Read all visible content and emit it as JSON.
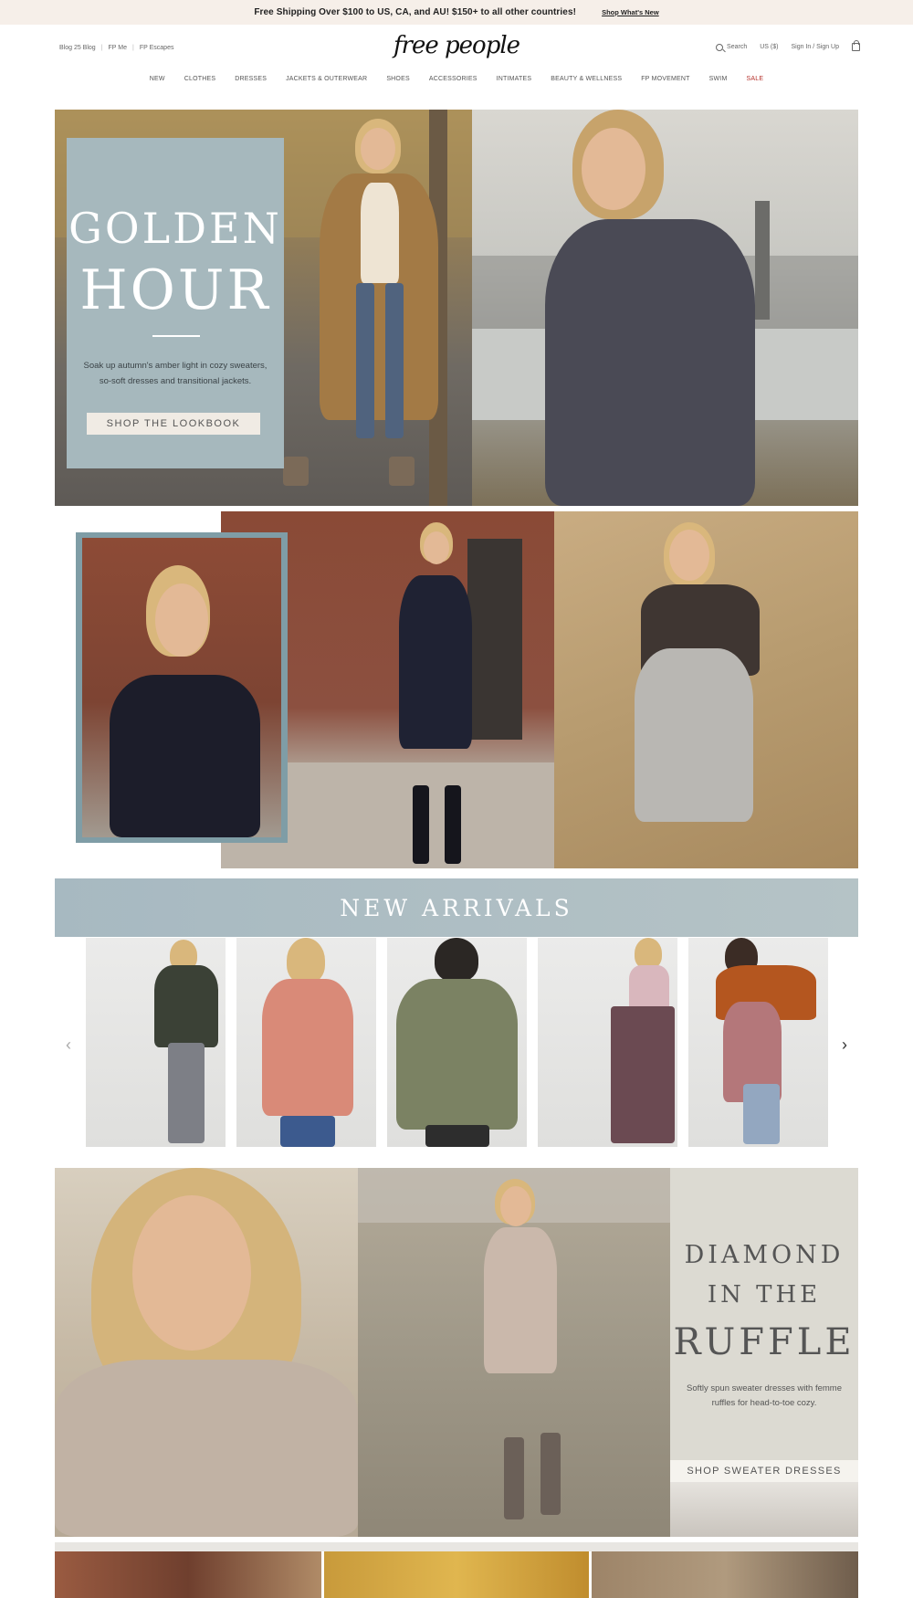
{
  "promo": {
    "message": "Free Shipping Over $100 to US, CA, and AU! $150+ to all other countries!",
    "link": "Shop What's New"
  },
  "header": {
    "util_left": [
      "Blog 25 Blog",
      "FP Me",
      "FP Escapes"
    ],
    "logo": "free people",
    "search": "Search",
    "currency": "US ($)",
    "account": "Sign In / Sign Up",
    "icons": [
      "search-icon",
      "shopping-bag-icon"
    ]
  },
  "nav": {
    "items": [
      "NEW",
      "CLOTHES",
      "DRESSES",
      "JACKETS & OUTERWEAR",
      "SHOES",
      "ACCESSORIES",
      "INTIMATES",
      "BEAUTY & WELLNESS",
      "FP MOVEMENT",
      "SWIM",
      "SALE"
    ],
    "sale_color": "#b5302a"
  },
  "hero": {
    "title_line1": "GOLDEN",
    "title_line2": "HOUR",
    "description": "Soak up autumn's amber light in cozy sweaters, so-soft dresses and transitional jackets.",
    "cta": "SHOP THE LOOKBOOK",
    "box_color": "#a6b8bd"
  },
  "new_arrivals": {
    "title": "NEW ARRIVALS",
    "products": [
      "product-1",
      "product-2",
      "product-3",
      "product-4",
      "product-5"
    ],
    "prev_arrow": "chevron-left-icon",
    "next_arrow": "chevron-right-icon"
  },
  "diamond": {
    "title_line1": "DIAMOND",
    "title_line2": "IN THE",
    "title_line3": "RUFFLE",
    "description": "Softly spun sweater dresses with femme ruffles for head-to-toe cozy.",
    "cta": "SHOP SWEATER DRESSES"
  }
}
